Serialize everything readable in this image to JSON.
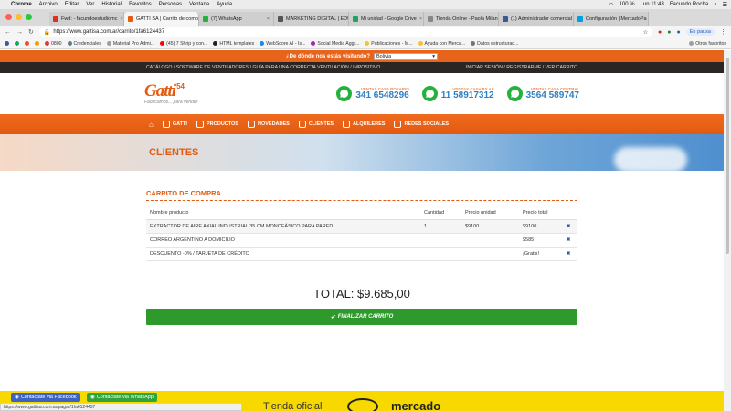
{
  "mac": {
    "app": "Chrome",
    "menus": [
      "Archivo",
      "Editar",
      "Ver",
      "Historial",
      "Favoritos",
      "Personas",
      "Ventana",
      "Ayuda"
    ],
    "battery": "100 %",
    "clock": "Lun 11:43",
    "user": "Facundo Rocha"
  },
  "tabs": [
    {
      "label": "Fwd: - facundoestudiomc",
      "color": "#d93025",
      "active": false
    },
    {
      "label": "GATTI SA | Carrito de comp",
      "color": "#e35b12",
      "active": true
    },
    {
      "label": "(7) WhatsApp",
      "color": "#25b13d",
      "active": false
    },
    {
      "label": "MARKETING DIGITAL | EDU",
      "color": "#555555",
      "active": false
    },
    {
      "label": "Mi unidad - Google Drive",
      "color": "#1da462",
      "active": false
    },
    {
      "label": "Tienda Online - Paola Milan",
      "color": "#888888",
      "active": false
    },
    {
      "label": "(1) Administrador comercial",
      "color": "#3b5998",
      "active": false
    },
    {
      "label": "Configuración | MercadoPa",
      "color": "#009ee3",
      "active": false
    }
  ],
  "address": {
    "url": "https://www.gattisa.com.ar/carrito/1fa6124437",
    "paused": "En pausa"
  },
  "bookmarks": [
    {
      "label": "0800",
      "color": "#e53935"
    },
    {
      "label": "Credenciales",
      "color": "#607d8b"
    },
    {
      "label": "Material Pro Admi...",
      "color": "#9e9e9e"
    },
    {
      "label": "(45) 7 Shrip y con...",
      "color": "#ff0000"
    },
    {
      "label": "HTML templates",
      "color": "#212121"
    },
    {
      "label": "WebScore AI - Is...",
      "color": "#1e88e5"
    },
    {
      "label": "Social Media Aggr...",
      "color": "#9c27b0"
    },
    {
      "label": "Publicaciones - M...",
      "color": "#fbc02d"
    },
    {
      "label": "Ayuda con Merca...",
      "color": "#fbc02d"
    },
    {
      "label": "Datos estructurad...",
      "color": "#757575"
    },
    {
      "label": "Otros favoritos",
      "color": "#9e9e9e"
    }
  ],
  "site": {
    "location_question": "¿De dónde nos estás visitando?",
    "location_value": "Bolivia",
    "topnav_left": "CATÁLOGO / SOFTWARE DE VENTILADORES / GUÍA PARA UNA CORRECTA VENTILACIÓN / IMPOSITIVO",
    "topnav_right": "INICIAR SESIÓN / REGISTRARME / VER CARRITO",
    "logo": "Gatti",
    "logo_badge": "54",
    "logo_tagline": "Fabricamos... para vender",
    "contacts": [
      {
        "label": "VENTAS CASA ROSARIO",
        "number": "341 6548296"
      },
      {
        "label": "VENTAS CASA BS AS",
        "number": "11 58917312"
      },
      {
        "label": "VENTAS CASA CENTRAL",
        "number": "3564 589747"
      }
    ],
    "nav": [
      "GATTI",
      "PRODUCTOS",
      "NOVEDADES",
      "CLIENTES",
      "ALQUILERES",
      "REDES SOCIALES"
    ],
    "hero_title": "CLIENTES"
  },
  "cart": {
    "title": "CARRITO DE COMPRA",
    "headers": [
      "Nombre producto",
      "Cantidad",
      "Precio unidad",
      "Precio total"
    ],
    "rows": [
      {
        "name": "EXTRACTOR DE AIRE AXIAL INDUSTRIAL 35 CM MONOFÁSICO PARA PARED",
        "qty": "1",
        "unit": "$9100",
        "total": "$9100"
      },
      {
        "name": "CORREO ARGENTINO A DOMICILIO",
        "qty": "",
        "unit": "",
        "total": "$585"
      },
      {
        "name": "DESCUENTO -0% / TARJETA DE CRÉDITO",
        "qty": "",
        "unit": "",
        "total": "¡Gratis!"
      }
    ],
    "remove_glyph": "✖",
    "total_label": "TOTAL: $9.685,00",
    "finalize": "FINALIZAR CARRITO"
  },
  "footer": {
    "tienda": "Tienda oficial",
    "mercado": "mercado",
    "facebook": "Contactate via Facebook",
    "whatsapp": "Contactate via WhatsApp",
    "status_url": "https://www.gattisa.com.ar/pagar/1fa6124437"
  }
}
